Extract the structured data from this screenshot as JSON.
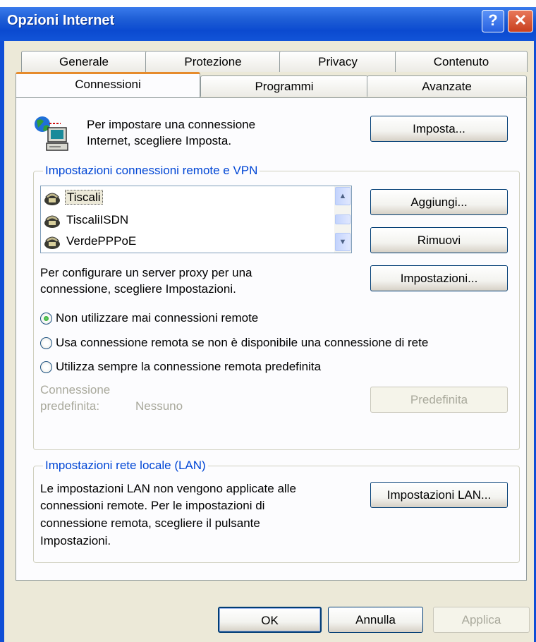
{
  "window": {
    "title": "Opzioni Internet",
    "help_label": "?",
    "close_label": "✕"
  },
  "tabs_back": [
    "Generale",
    "Protezione",
    "Privacy",
    "Contenuto"
  ],
  "tabs_front": [
    "Connessioni",
    "Programmi",
    "Avanzate"
  ],
  "selected_tab": "Connessioni",
  "setup": {
    "text_line1": "Per impostare una connessione",
    "text_line2": "Internet, scegliere Imposta.",
    "button": "Imposta..."
  },
  "dialup_group": {
    "legend": "Impostazioni connessioni remote e VPN",
    "connections": [
      "Tiscali",
      "TiscaliISDN",
      "VerdePPPoE"
    ],
    "selected": "Tiscali",
    "add_button": "Aggiungi...",
    "remove_button": "Rimuovi",
    "proxy_text_line1": "Per configurare un server proxy per una",
    "proxy_text_line2": "connessione, scegliere Impostazioni.",
    "settings_button": "Impostazioni...",
    "radio_options": [
      "Non utilizzare mai connessioni remote",
      "Usa connessione remota se non è disponibile una connessione di rete",
      "Utilizza sempre la connessione remota predefinita"
    ],
    "selected_radio": 0,
    "default_label_line1": "Connessione",
    "default_label_line2": "predefinita:",
    "default_value": "Nessuno",
    "default_button": "Predefinita"
  },
  "lan_group": {
    "legend": "Impostazioni rete locale (LAN)",
    "text_lines": [
      "Le impostazioni LAN non vengono applicate alle",
      "connessioni remote. Per le impostazioni di",
      "connessione remota, scegliere il pulsante",
      "Impostazioni."
    ],
    "button": "Impostazioni LAN..."
  },
  "footer": {
    "ok": "OK",
    "cancel": "Annulla",
    "apply": "Applica"
  },
  "icons": {
    "setup": "network-globe-computer-icon",
    "connection": "dialup-phone-icon"
  },
  "colors": {
    "titlebar": "#0b4ad0",
    "dialog_bg": "#ece9d8",
    "legend": "#0046d5",
    "selected_tab_accent": "#e68b2c"
  }
}
